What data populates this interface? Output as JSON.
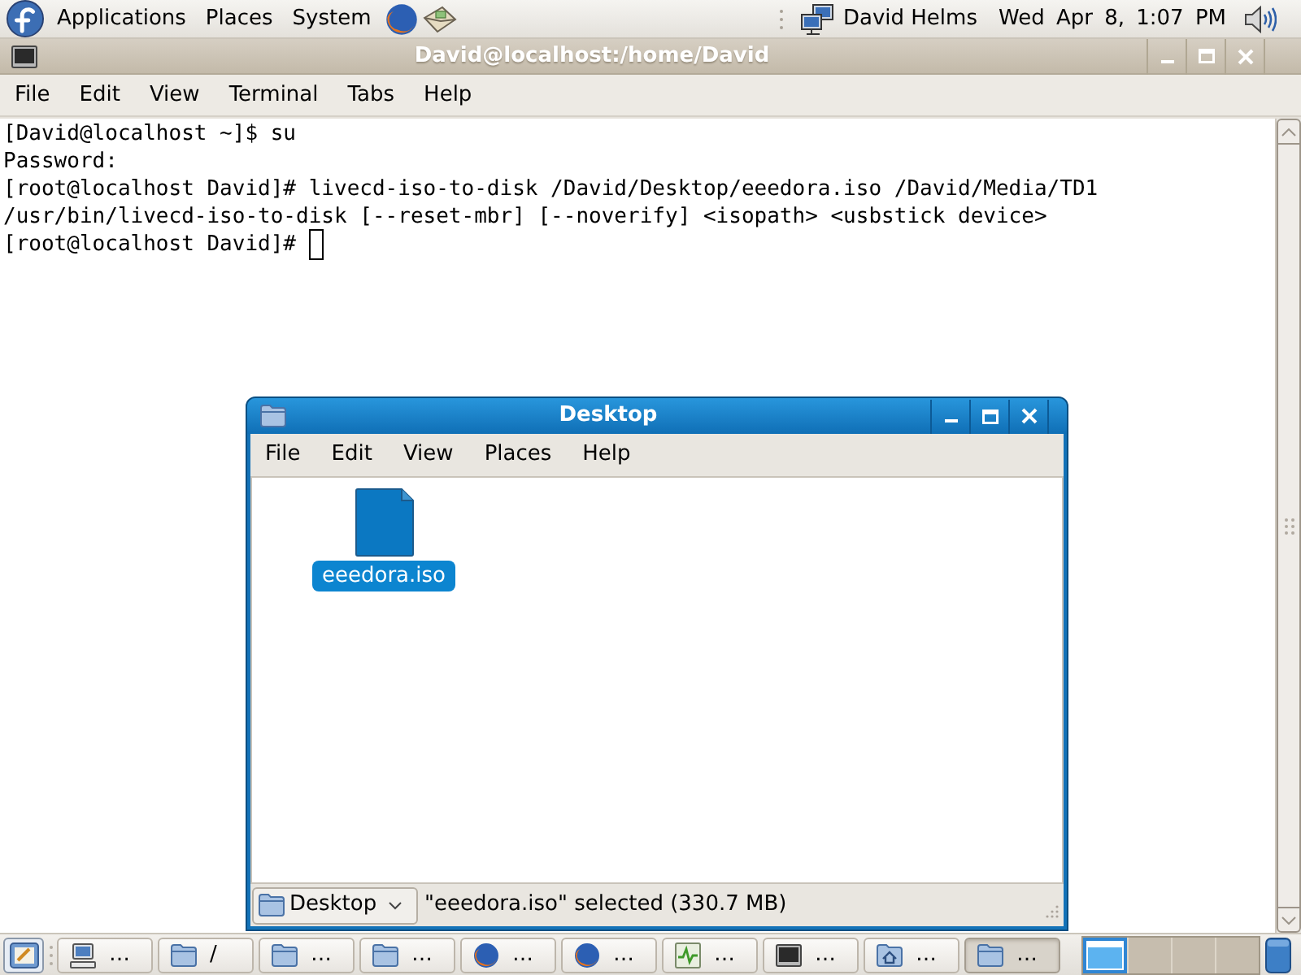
{
  "top_panel": {
    "menus": [
      "Applications",
      "Places",
      "System"
    ],
    "user": "David Helms",
    "clock": "Wed Apr 8, 1:07 PM"
  },
  "terminal": {
    "title": "David@localhost:/home/David",
    "menu": [
      "File",
      "Edit",
      "View",
      "Terminal",
      "Tabs",
      "Help"
    ],
    "lines": [
      "[David@localhost ~]$ su",
      "Password:",
      "[root@localhost David]# livecd-iso-to-disk /David/Desktop/eeedora.iso /David/Media/TD1",
      "/usr/bin/livecd-iso-to-disk [--reset-mbr] [--noverify] <isopath> <usbstick device>",
      "[root@localhost David]#"
    ],
    "cursor": true
  },
  "file_manager": {
    "title": "Desktop",
    "menu": [
      "File",
      "Edit",
      "View",
      "Places",
      "Help"
    ],
    "files": [
      {
        "name": "eeedora.iso",
        "selected": true
      }
    ],
    "location": "Desktop",
    "status": "\"eeedora.iso\" selected (330.7 MB)"
  },
  "taskbar": {
    "tasks": [
      {
        "kind": "computer",
        "label": "…",
        "selected": false
      },
      {
        "kind": "folder",
        "label": "/",
        "selected": false
      },
      {
        "kind": "folder",
        "label": "…",
        "selected": false
      },
      {
        "kind": "folder",
        "label": "…",
        "selected": false
      },
      {
        "kind": "browser",
        "label": "…",
        "selected": false
      },
      {
        "kind": "browser",
        "label": "…",
        "selected": false
      },
      {
        "kind": "monitor",
        "label": "…",
        "selected": false
      },
      {
        "kind": "terminal",
        "label": "…",
        "selected": false
      },
      {
        "kind": "home",
        "label": "…",
        "selected": false
      },
      {
        "kind": "folder",
        "label": "…",
        "selected": true
      }
    ],
    "workspaces": [
      {
        "selected": true
      },
      {
        "selected": false
      },
      {
        "selected": false
      },
      {
        "selected": false
      }
    ]
  }
}
